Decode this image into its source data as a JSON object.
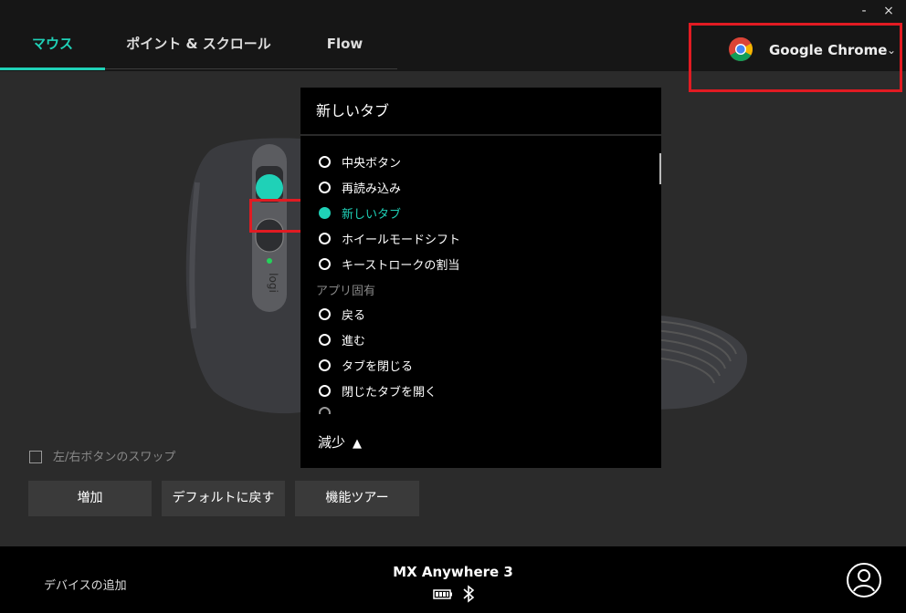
{
  "window": {
    "minimize_label": "-",
    "close_label": "×"
  },
  "tabs": [
    {
      "label": "マウス",
      "active": true
    },
    {
      "label": "ポイント & スクロール",
      "active": false
    },
    {
      "label": "Flow",
      "active": false
    }
  ],
  "app_selector": {
    "name": "Google Chrome",
    "icon": "chrome-logo-icon",
    "chevron": "chevron-down-icon"
  },
  "accent_color": "#1fd1b7",
  "highlight_color": "#e11b22",
  "menu": {
    "title": "新しいタブ",
    "items": [
      {
        "label": "中央ボタン",
        "selected": false
      },
      {
        "label": "再読み込み",
        "selected": false
      },
      {
        "label": "新しいタブ",
        "selected": true
      },
      {
        "label": "ホイールモードシフト",
        "selected": false
      },
      {
        "label": "キーストロークの割当",
        "selected": false
      }
    ],
    "group_label": "アプリ固有",
    "app_items": [
      {
        "label": "戻る",
        "selected": false
      },
      {
        "label": "進む",
        "selected": false
      },
      {
        "label": "タブを閉じる",
        "selected": false
      },
      {
        "label": "閉じたタブを開く",
        "selected": false
      }
    ],
    "less_label": "減少"
  },
  "swap_checkbox": {
    "label": "左/右ボタンのスワップ",
    "checked": false
  },
  "buttons": {
    "add": "増加",
    "reset": "デフォルトに戻す",
    "tour": "機能ツアー"
  },
  "footer": {
    "add_device": "デバイスの追加",
    "device_name": "MX Anywhere 3",
    "icons": [
      "battery-icon",
      "bluetooth-icon"
    ],
    "account_icon": "account-icon"
  }
}
